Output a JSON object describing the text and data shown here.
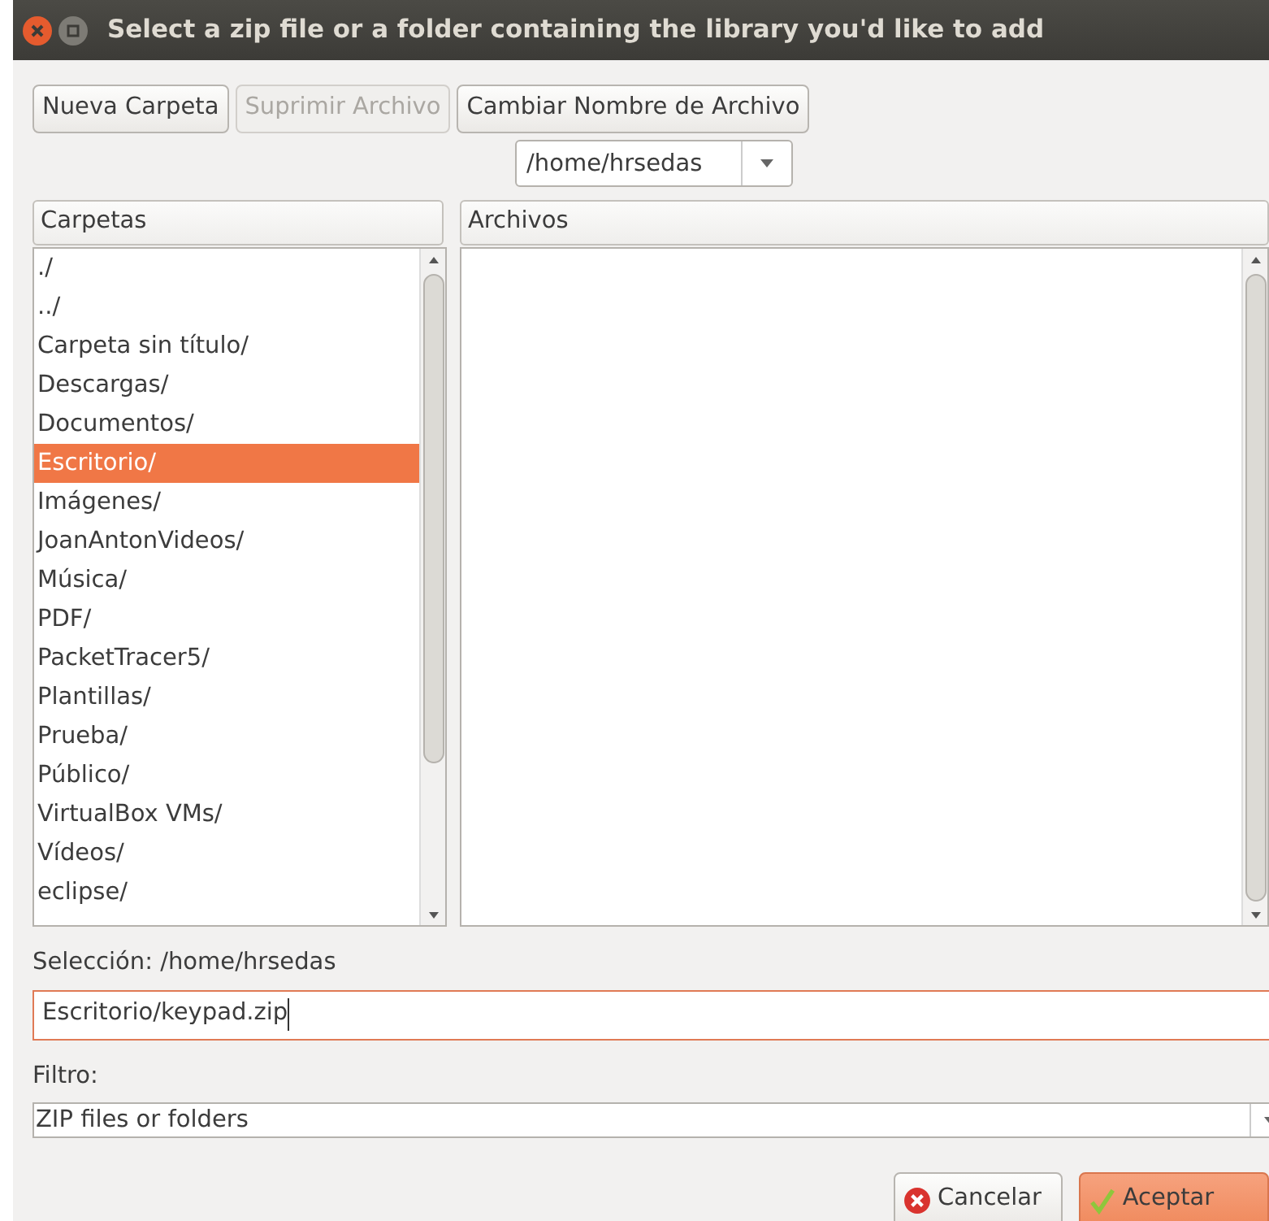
{
  "window": {
    "title": "Select a zip file or a folder containing the library you'd like to add"
  },
  "toolbar": [
    {
      "label": "Nueva Carpeta",
      "disabled": false
    },
    {
      "label": "Suprimir Archivo",
      "disabled": true
    },
    {
      "label": "Cambiar Nombre de Archivo",
      "disabled": false
    }
  ],
  "path_combo": {
    "value": "/home/hrsedas"
  },
  "folders": {
    "header": "Carpetas",
    "items": [
      {
        "label": "./",
        "selected": false
      },
      {
        "label": "../",
        "selected": false
      },
      {
        "label": "Carpeta sin título/",
        "selected": false
      },
      {
        "label": "Descargas/",
        "selected": false
      },
      {
        "label": "Documentos/",
        "selected": false
      },
      {
        "label": "Escritorio/",
        "selected": true
      },
      {
        "label": "Imágenes/",
        "selected": false
      },
      {
        "label": "JoanAntonVideos/",
        "selected": false
      },
      {
        "label": "Música/",
        "selected": false
      },
      {
        "label": "PDF/",
        "selected": false
      },
      {
        "label": "PacketTracer5/",
        "selected": false
      },
      {
        "label": "Plantillas/",
        "selected": false
      },
      {
        "label": "Prueba/",
        "selected": false
      },
      {
        "label": "Público/",
        "selected": false
      },
      {
        "label": "VirtualBox VMs/",
        "selected": false
      },
      {
        "label": "Vídeos/",
        "selected": false
      },
      {
        "label": "eclipse/",
        "selected": false
      }
    ]
  },
  "files": {
    "header": "Archivos"
  },
  "selection": {
    "label": "Selección: /home/hrsedas",
    "value": "Escritorio/keypad.zip"
  },
  "filter": {
    "label": "Filtro:",
    "value": "ZIP files or folders"
  },
  "buttons": [
    {
      "kind": "cancel",
      "label": "Cancelar"
    },
    {
      "kind": "ok",
      "label": "Aceptar"
    }
  ]
}
